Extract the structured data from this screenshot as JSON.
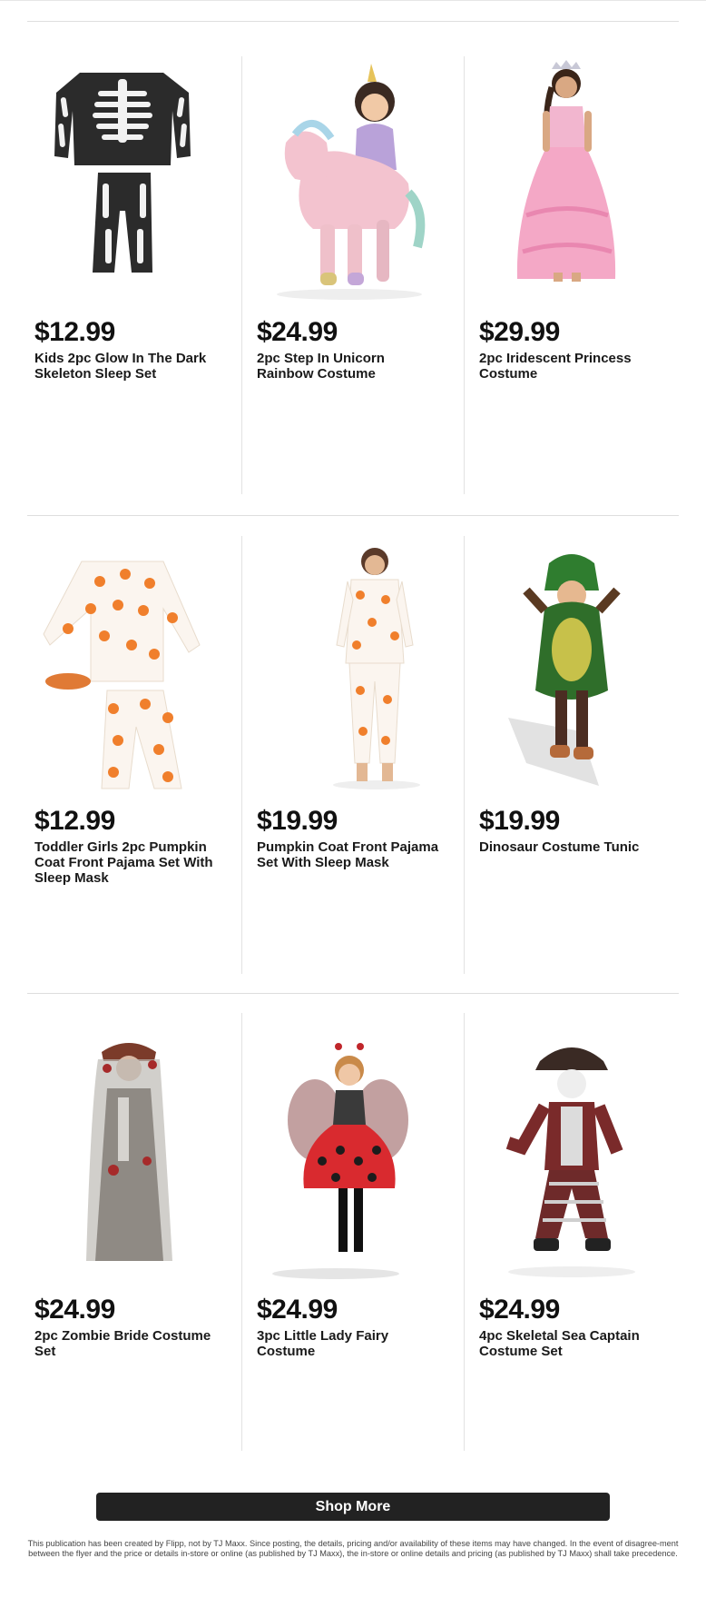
{
  "products": [
    {
      "price": "$12.99",
      "name": "Kids 2pc Glow In The Dark Skeleton Sleep Set",
      "image_icon": "skeleton-pajama-set"
    },
    {
      "price": "$24.99",
      "name": "2pc Step In Unicorn Rainbow Costume",
      "image_icon": "unicorn-costume"
    },
    {
      "price": "$29.99",
      "name": "2pc Iridescent Princess Costume",
      "image_icon": "princess-costume"
    },
    {
      "price": "$12.99",
      "name": "Toddler Girls 2pc Pumpkin Coat Front Pajama Set With Sleep Mask",
      "image_icon": "pumpkin-pajama-set"
    },
    {
      "price": "$19.99",
      "name": "Pumpkin Coat Front Pajama Set With Sleep Mask",
      "image_icon": "pumpkin-pajama-model"
    },
    {
      "price": "$19.99",
      "name": "Dinosaur Costume Tunic",
      "image_icon": "dinosaur-costume"
    },
    {
      "price": "$24.99",
      "name": "2pc Zombie Bride Costume Set",
      "image_icon": "zombie-bride-costume"
    },
    {
      "price": "$24.99",
      "name": "3pc Little Lady Fairy Costume",
      "image_icon": "ladybug-fairy-costume"
    },
    {
      "price": "$24.99",
      "name": "4pc Skeletal Sea Captain Costume Set",
      "image_icon": "skeleton-pirate-costume"
    }
  ],
  "shop_more_label": "Shop More",
  "disclaimer": "This publication has been created by Flipp, not by TJ Maxx. Since posting, the details, pricing and/or availability of these items may have changed. In the event of disagree-ment between the flyer and the price or details in-store or online (as published by TJ Maxx), the in-store or online details and pricing (as published by TJ Maxx) shall take precedence.",
  "colors": {
    "button": "#222222",
    "divider": "#dedede"
  }
}
